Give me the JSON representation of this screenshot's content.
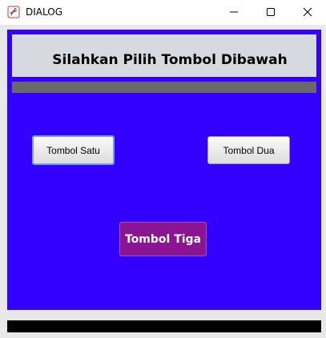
{
  "window": {
    "title": "DIALOG",
    "icons": {
      "app": "app-icon",
      "minimize": "minimize-icon",
      "maximize": "maximize-icon",
      "close": "close-icon"
    }
  },
  "header": {
    "title": "Silahkan Pilih Tombol Dibawah"
  },
  "buttons": {
    "satu": "Tombol Satu",
    "dua": "Tombol Dua",
    "tiga": "Tombol Tiga"
  },
  "colors": {
    "panel_background": "#3300ff",
    "header_background": "#d6d9e0",
    "gray_bar": "#696969",
    "tiga_button": "#8a1491",
    "bottom_bar": "#000000"
  }
}
